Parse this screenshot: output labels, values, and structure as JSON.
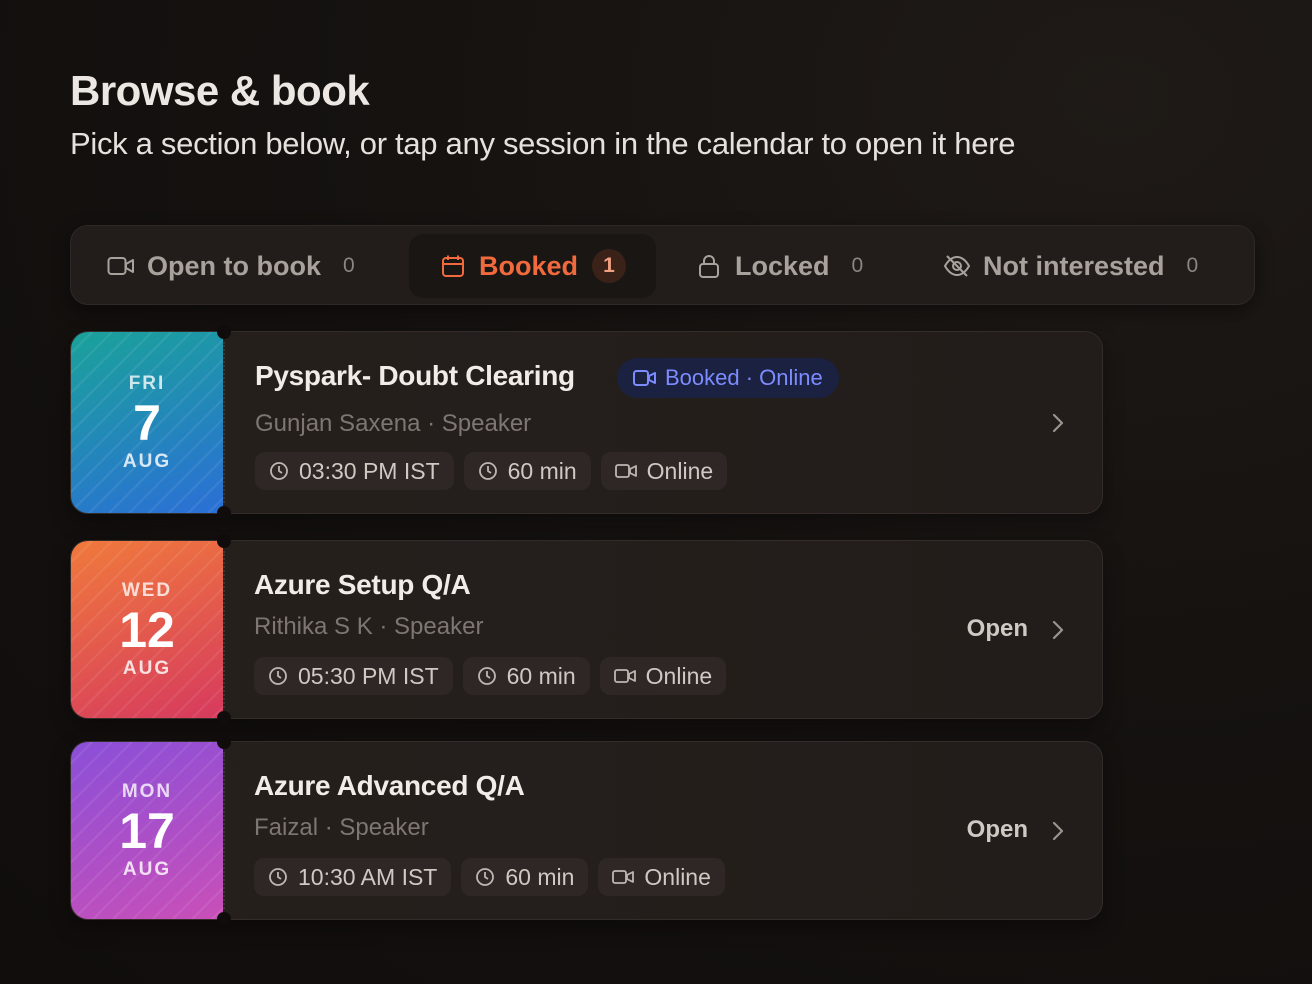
{
  "header": {
    "title": "Browse & book",
    "subtitle": "Pick a section below, or tap any session in the calendar to open it here"
  },
  "tabs": [
    {
      "label": "Open to book",
      "count": "0",
      "icon": "video-icon",
      "active": false
    },
    {
      "label": "Booked",
      "count": "1",
      "icon": "calendar-icon",
      "active": true
    },
    {
      "label": "Locked",
      "count": "0",
      "icon": "lock-icon",
      "active": false
    },
    {
      "label": "Not interested",
      "count": "0",
      "icon": "eye-off-icon",
      "active": false
    }
  ],
  "sessions": [
    {
      "dow": "FRI",
      "day": "7",
      "month": "AUG",
      "title": "Pyspark- Doubt Clearing",
      "status_pill": "Booked · Online",
      "speaker": "Gunjan Saxena · Speaker",
      "time": "03:30 PM IST",
      "duration": "60 min",
      "mode": "Online",
      "action": "",
      "gradient": [
        "#1aa29a",
        "#2b6fd6"
      ]
    },
    {
      "dow": "WED",
      "day": "12",
      "month": "AUG",
      "title": "Azure Setup Q/A",
      "status_pill": "",
      "speaker": "Rithika S K · Speaker",
      "time": "05:30 PM IST",
      "duration": "60 min",
      "mode": "Online",
      "action": "Open",
      "gradient": [
        "#f07a3c",
        "#d63a5e"
      ]
    },
    {
      "dow": "MON",
      "day": "17",
      "month": "AUG",
      "title": "Azure Advanced Q/A",
      "status_pill": "",
      "speaker": "Faizal · Speaker",
      "time": "10:30 AM IST",
      "duration": "60 min",
      "mode": "Online",
      "action": "Open",
      "gradient": [
        "#8a4fd8",
        "#c94fb8"
      ]
    }
  ],
  "colors": {
    "accent": "#f06a3d",
    "pill_bg": "#1b2140",
    "pill_text": "#7c8cff"
  }
}
